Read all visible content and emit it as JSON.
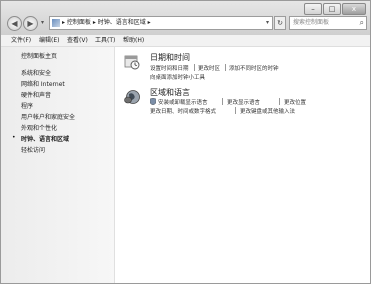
{
  "window": {
    "address_path": "▸ 控制面板 ▸ 时钟、语言和区域 ▸",
    "search_placeholder": "搜索控制面板",
    "controls": {
      "minimize": "–",
      "maximize": "□",
      "close": "x"
    },
    "nav": {
      "back": "◀",
      "forward": "▶",
      "dropdown": "▾",
      "refresh": "↻"
    }
  },
  "menu": [
    "文件(F)",
    "编辑(E)",
    "查看(V)",
    "工具(T)",
    "帮助(H)"
  ],
  "sidebar": {
    "home": "控制面板主页",
    "items": [
      "系统和安全",
      "网络和 Internet",
      "硬件和声音",
      "程序",
      "用户帐户和家庭安全",
      "外观和个性化",
      "时钟、语言和区域",
      "轻松访问"
    ],
    "active_marker": "•"
  },
  "categories": [
    {
      "title": "日期和时间",
      "icon": "clock-icon",
      "row1": [
        "设置时间和日期",
        "更改时区",
        "添加不同时区的时钟"
      ],
      "row2": [
        "向桌面添加时钟小工具"
      ]
    },
    {
      "title": "区域和语言",
      "icon": "globe-icon",
      "row1": [
        "安装或卸载显示语言",
        "更改显示语言",
        "更改位置"
      ],
      "row2": [
        "更改日期、时间或数字格式",
        "更改键盘或其他输入法"
      ]
    }
  ]
}
